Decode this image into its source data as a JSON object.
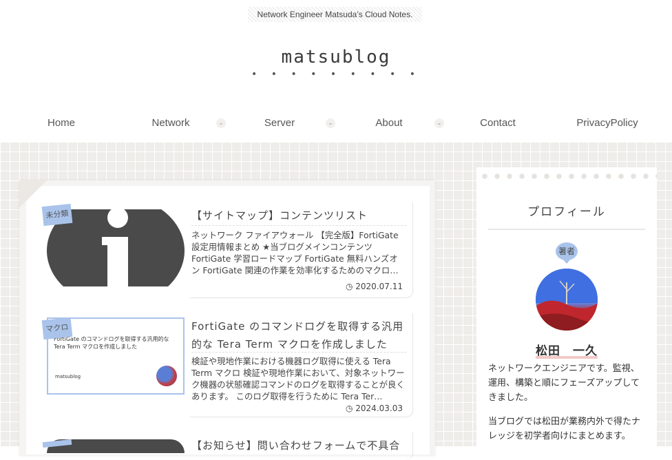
{
  "header": {
    "tagline": "Network Engineer Matsuda’s Cloud Notes.",
    "site_title": "matsublog",
    "site_dots": "• • • • • • • • •"
  },
  "nav": [
    {
      "label": "Home"
    },
    {
      "label": "Network"
    },
    {
      "label": "Server"
    },
    {
      "label": "About"
    },
    {
      "label": "Contact"
    },
    {
      "label": "PrivacyPolicy"
    }
  ],
  "posts": [
    {
      "category": "未分類",
      "title": "【サイトマップ】コンテンツリスト",
      "excerpt": "ネットワーク ファイアウォール 【完全版】FortiGate設定用情報まとめ ★当ブログメインコンテンツ FortiGate 学習ロードマップ FortiGate 無料ハンズオン FortiGate 関連の作業を効率化するためのマクロ…",
      "date": "2020.07.11"
    },
    {
      "category": "マクロ",
      "title": "FortiGate のコマンドログを取得する汎用的な Tera Term マクロを作成しました",
      "excerpt": "検証や現地作業における機器ログ取得に使える Tera Term マクロ 検証や現地作業において、対象ネットワーク機器の状態確認コマンドのログを取得することが良くあります。 このログ取得を行うために Tera Ter…",
      "date": "2024.03.03",
      "thumb_title": "FortiGate のコマンドログを取得する汎用的な Tera Term マクロを作成しました",
      "thumb_site": "matsublog"
    },
    {
      "title": "【お知らせ】問い合わせフォームで不具合"
    }
  ],
  "date_icon": "clock-icon",
  "sidebar": {
    "heading": "プロフィール",
    "badge": "著者",
    "name": "松田　一久",
    "bio1": "ネットワークエンジニアです。監視、運用、構築と順にフェーズアップしてきました。",
    "bio2": "当ブログでは松田が業務内外で得たナレッジを初学者向けにまとめます。"
  },
  "colors": {
    "accent": "#a9c3ea",
    "background": "#efedea",
    "name_underline": "#f4c9c9"
  }
}
